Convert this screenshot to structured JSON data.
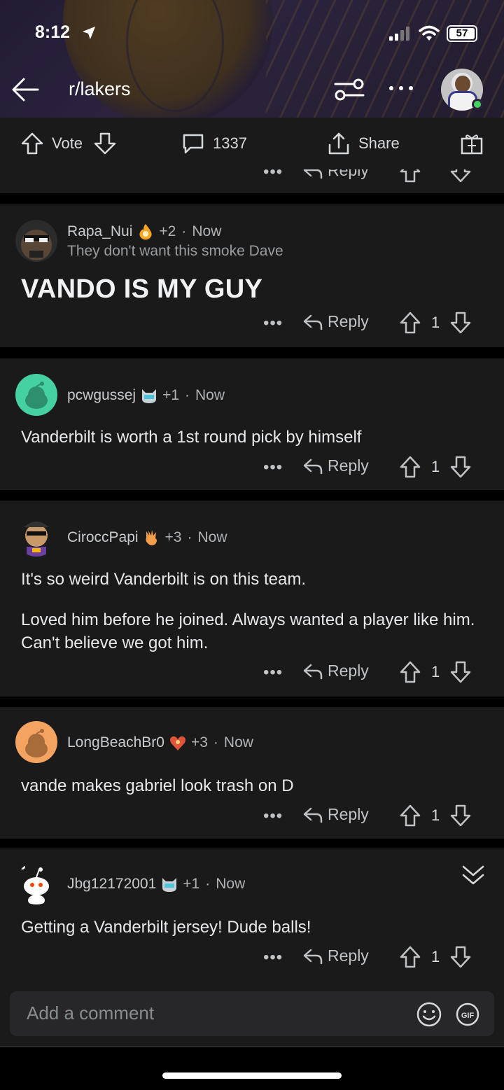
{
  "status_bar": {
    "time": "8:12",
    "battery": "57"
  },
  "nav": {
    "subreddit": "r/lakers"
  },
  "action_bar": {
    "vote_label": "Vote",
    "comment_count": "1337",
    "share_label": "Share"
  },
  "partial_row": {
    "reply_label": "Reply"
  },
  "comments": [
    {
      "username": "Rapa_Nui",
      "karma": "+2",
      "time": "Now",
      "flair": "They don't want this smoke Dave",
      "text": "VANDO IS MY GUY",
      "reply_label": "Reply",
      "votes": "1"
    },
    {
      "username": "pcwgussej",
      "karma": "+1",
      "time": "Now",
      "text": "Vanderbilt is worth a 1st round pick by himself",
      "reply_label": "Reply",
      "votes": "1"
    },
    {
      "username": "CiroccPapi",
      "karma": "+3",
      "time": "Now",
      "text_line1": "It's so weird Vanderbilt is on this team.",
      "text_line2": "Loved him before he joined. Always wanted a player like him. Can't believe we got him.",
      "reply_label": "Reply",
      "votes": "1"
    },
    {
      "username": "LongBeachBr0",
      "karma": "+3",
      "time": "Now",
      "text": "vande makes gabriel look trash on D",
      "reply_label": "Reply",
      "votes": "1"
    },
    {
      "username": "Jbg12172001",
      "karma": "+1",
      "time": "Now",
      "text": "Getting a Vanderbilt jersey! Dude balls!",
      "reply_label": "Reply",
      "votes": "1"
    }
  ],
  "composer": {
    "placeholder": "Add a comment",
    "gif_label": "GIF"
  },
  "colors": {
    "background": "#000000",
    "card": "#1a1a1b",
    "text": "#d7dadc",
    "online": "#46d160"
  }
}
